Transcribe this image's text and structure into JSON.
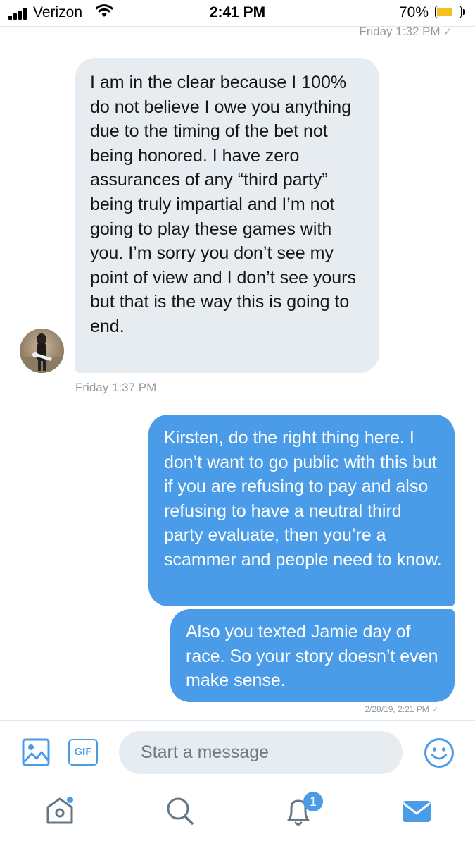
{
  "status_bar": {
    "carrier": "Verizon",
    "time": "2:41 PM",
    "battery_percent": "70%",
    "battery_level": 0.7
  },
  "conversation": {
    "top_timestamp": "Friday 1:32 PM",
    "messages": [
      {
        "direction": "incoming",
        "text": "I am in the clear because I 100% do not believe I owe you anything due to the timing of the bet not being honored. I have zero assurances of any “third party” being truly impartial and I’m not going to play these games with you. I’m sorry you don’t see my point of view and I don’t see yours but that is the way this is going to end.",
        "timestamp": "Friday 1:37 PM"
      },
      {
        "direction": "outgoing",
        "text": "Kirsten, do the right thing here. I don’t want to go public with this but if you are refusing to pay and also refusing to have a neutral third party evaluate, then you’re a scammer and people need to know."
      },
      {
        "direction": "outgoing",
        "text": "Also you texted Jamie day of race. So your story doesn’t even make sense.",
        "timestamp": "2/28/19, 2:21 PM"
      }
    ],
    "read_mark": "✓"
  },
  "composer": {
    "placeholder": "Start a message",
    "gif_label": "GIF"
  },
  "tab_bar": {
    "notification_count": "1"
  },
  "colors": {
    "accent": "#4a9ce8",
    "incoming_bubble": "#e6ecf0",
    "timestamp": "#8e9aa4",
    "battery": "#f4c020"
  }
}
